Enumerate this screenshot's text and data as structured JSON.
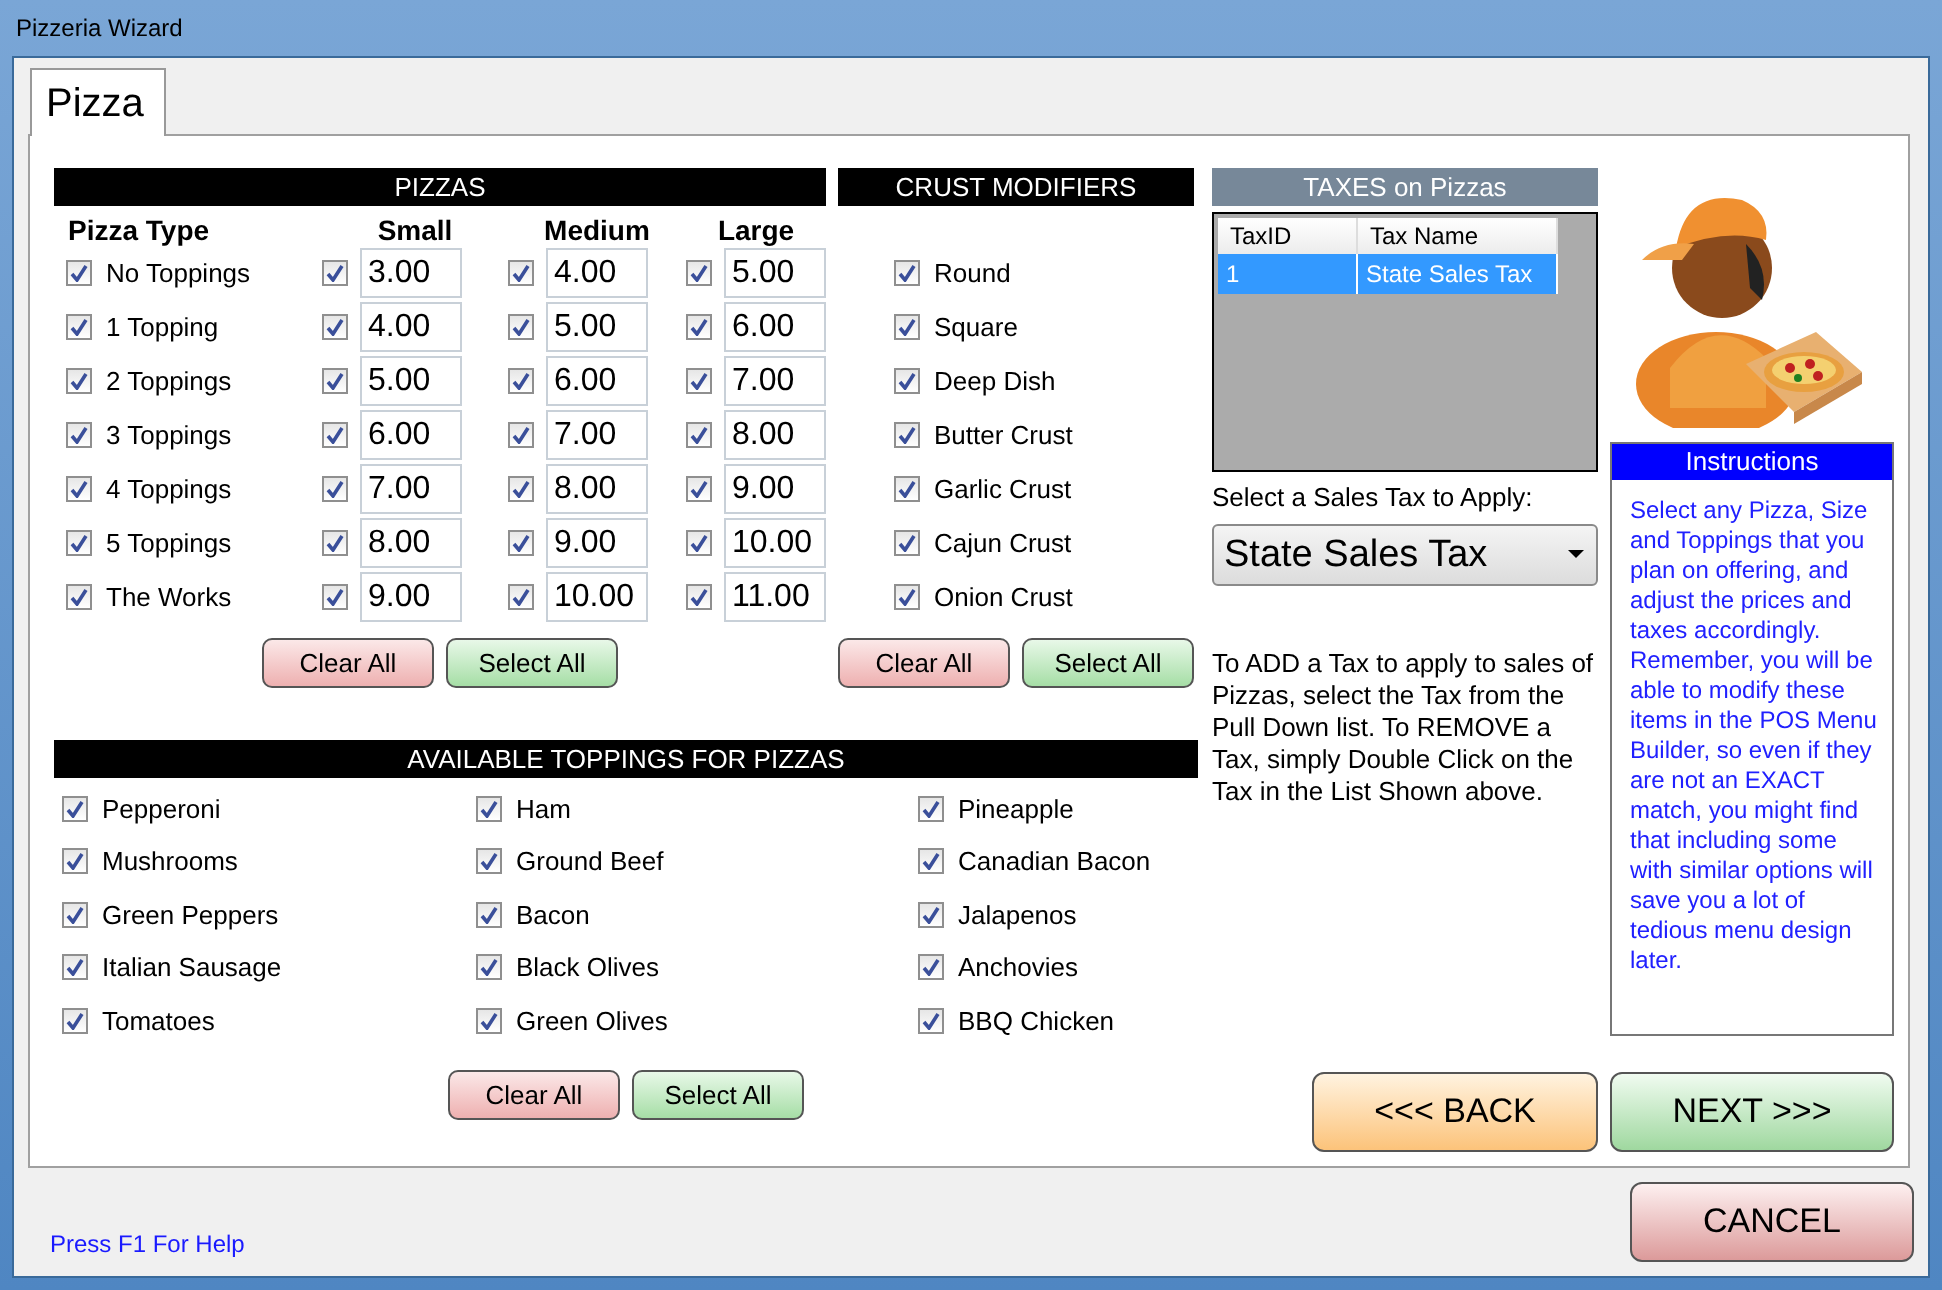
{
  "window": {
    "title": "Pizzeria Wizard"
  },
  "tabs": [
    {
      "label": "Pizza",
      "selected": true
    }
  ],
  "pizzas": {
    "title": "PIZZAS",
    "type_heading": "Pizza Type",
    "sizes": [
      "Small",
      "Medium",
      "Large"
    ],
    "rows": [
      {
        "label": "No Toppings",
        "checked": true,
        "prices": [
          {
            "value": "3.00",
            "checked": true
          },
          {
            "value": "4.00",
            "checked": true
          },
          {
            "value": "5.00",
            "checked": true
          }
        ]
      },
      {
        "label": "1 Topping",
        "checked": true,
        "prices": [
          {
            "value": "4.00",
            "checked": true
          },
          {
            "value": "5.00",
            "checked": true
          },
          {
            "value": "6.00",
            "checked": true
          }
        ]
      },
      {
        "label": "2 Toppings",
        "checked": true,
        "prices": [
          {
            "value": "5.00",
            "checked": true
          },
          {
            "value": "6.00",
            "checked": true
          },
          {
            "value": "7.00",
            "checked": true
          }
        ]
      },
      {
        "label": "3 Toppings",
        "checked": true,
        "prices": [
          {
            "value": "6.00",
            "checked": true
          },
          {
            "value": "7.00",
            "checked": true
          },
          {
            "value": "8.00",
            "checked": true
          }
        ]
      },
      {
        "label": "4 Toppings",
        "checked": true,
        "prices": [
          {
            "value": "7.00",
            "checked": true
          },
          {
            "value": "8.00",
            "checked": true
          },
          {
            "value": "9.00",
            "checked": true
          }
        ]
      },
      {
        "label": "5 Toppings",
        "checked": true,
        "prices": [
          {
            "value": "8.00",
            "checked": true
          },
          {
            "value": "9.00",
            "checked": true
          },
          {
            "value": "10.00",
            "checked": true
          }
        ]
      },
      {
        "label": "The Works",
        "checked": true,
        "prices": [
          {
            "value": "9.00",
            "checked": true
          },
          {
            "value": "10.00",
            "checked": true
          },
          {
            "value": "11.00",
            "checked": true
          }
        ]
      }
    ],
    "buttons": [
      "Clear All",
      "Select All"
    ]
  },
  "crust": {
    "title": "CRUST MODIFIERS",
    "items": [
      {
        "label": "Round",
        "checked": true
      },
      {
        "label": "Square",
        "checked": true
      },
      {
        "label": "Deep Dish",
        "checked": true
      },
      {
        "label": "Butter Crust",
        "checked": true
      },
      {
        "label": "Garlic Crust",
        "checked": true
      },
      {
        "label": "Cajun Crust",
        "checked": true
      },
      {
        "label": "Onion Crust",
        "checked": true
      }
    ],
    "buttons": [
      "Clear All",
      "Select All"
    ]
  },
  "toppings": {
    "title": "AVAILABLE TOPPINGS FOR PIZZAS",
    "columns": [
      [
        {
          "label": "Pepperoni",
          "checked": true
        },
        {
          "label": "Mushrooms",
          "checked": true
        },
        {
          "label": "Green Peppers",
          "checked": true
        },
        {
          "label": "Italian Sausage",
          "checked": true
        },
        {
          "label": "Tomatoes",
          "checked": true
        }
      ],
      [
        {
          "label": "Ham",
          "checked": true
        },
        {
          "label": "Ground Beef",
          "checked": true
        },
        {
          "label": "Bacon",
          "checked": true
        },
        {
          "label": "Black Olives",
          "checked": true
        },
        {
          "label": "Green Olives",
          "checked": true
        }
      ],
      [
        {
          "label": "Pineapple",
          "checked": true
        },
        {
          "label": "Canadian Bacon",
          "checked": true
        },
        {
          "label": "Jalapenos",
          "checked": true
        },
        {
          "label": "Anchovies",
          "checked": true
        },
        {
          "label": "BBQ Chicken",
          "checked": true
        }
      ]
    ],
    "buttons": [
      "Clear All",
      "Select All"
    ]
  },
  "taxes": {
    "title": "TAXES on Pizzas",
    "columns": [
      "TaxID",
      "Tax Name"
    ],
    "rows": [
      {
        "cells": [
          "1",
          "State Sales Tax"
        ],
        "selected": true
      }
    ],
    "select_label": "Select a Sales Tax to Apply:",
    "select_value": "State Sales Tax",
    "help": "To ADD a Tax to apply to sales of Pizzas, select the Tax from the Pull Down list.  To REMOVE a Tax, simply Double Click on the Tax in the List Shown above."
  },
  "instructions": {
    "title": "Instructions",
    "text": "Select any Pizza, Size and Toppings that you plan on offering, and adjust the prices and taxes accordingly. Remember, you will be able to modify these items in the POS Menu Builder, so even if they are not an EXACT match, you might find that including some with similar options will save you a lot of tedious menu design later."
  },
  "nav": {
    "back": "<<< BACK",
    "next": "NEXT >>>",
    "cancel": "CANCEL"
  },
  "status": {
    "help": "Press F1 For Help"
  }
}
